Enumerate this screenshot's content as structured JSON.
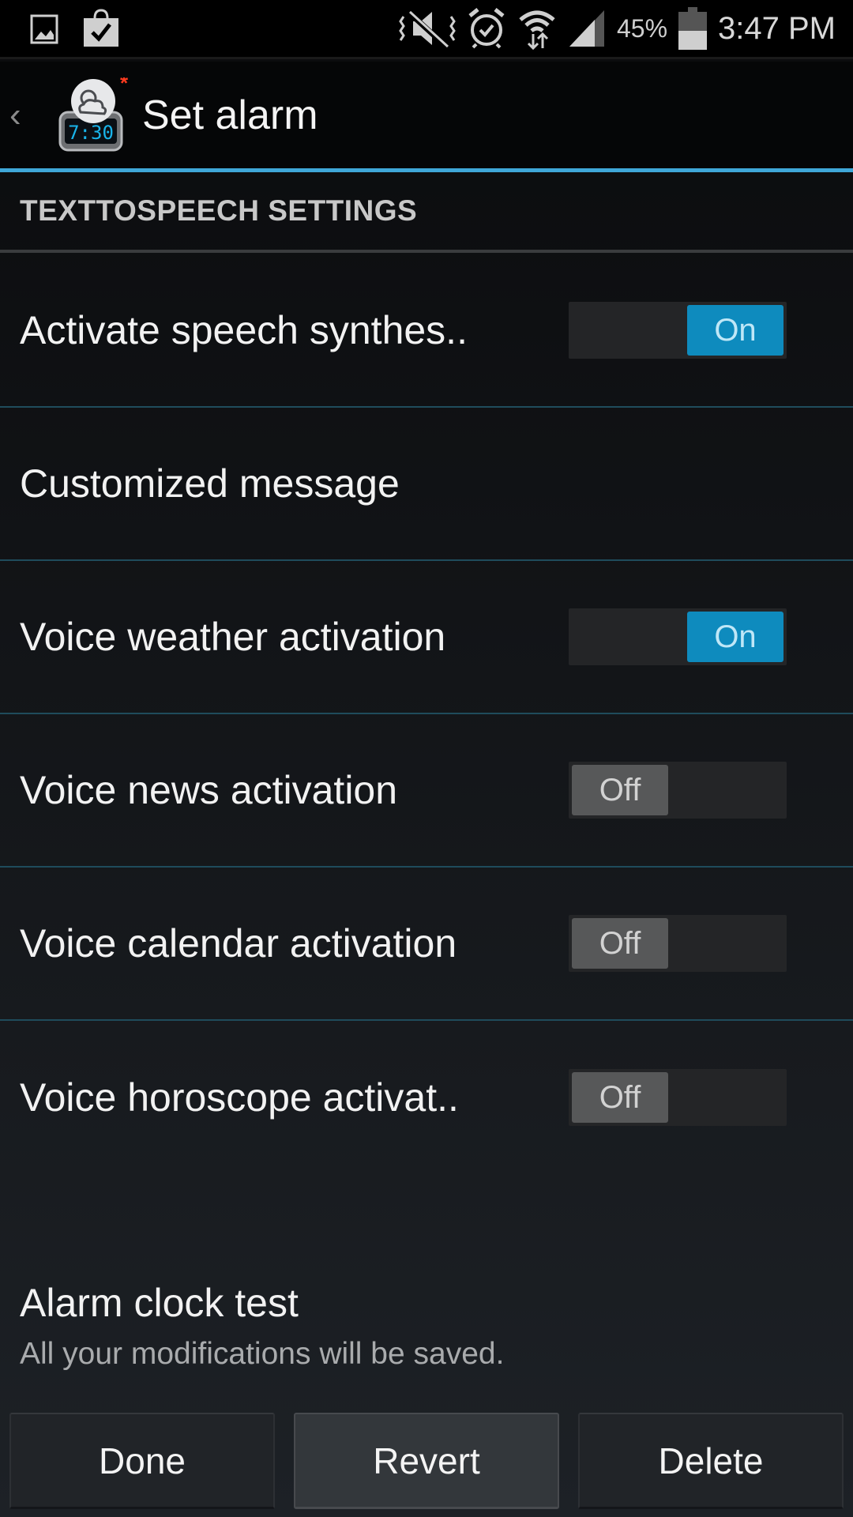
{
  "status_bar": {
    "left_icons": [
      "gallery-icon",
      "shopping-bag-check-icon"
    ],
    "right_icons": [
      "vibrate-mute-icon",
      "alarm-icon",
      "wifi-icon",
      "signal-icon"
    ],
    "battery_percent": "45%",
    "battery_level": 0.45,
    "time": "3:47 PM"
  },
  "action_bar": {
    "back_glyph": "‹",
    "app_icon": "weather-alarm-clock-icon",
    "app_icon_clock": "7:30",
    "title": "Set alarm"
  },
  "section": {
    "title": "TEXTTOSPEECH SETTINGS"
  },
  "settings": [
    {
      "label": "Activate speech synthes..",
      "toggle": "On",
      "state": true
    },
    {
      "label": "Customized message"
    },
    {
      "label": "Voice weather activation",
      "toggle": "On",
      "state": true
    },
    {
      "label": "Voice news activation",
      "toggle": "Off",
      "state": false
    },
    {
      "label": "Voice calendar activation",
      "toggle": "Off",
      "state": false
    },
    {
      "label": "Voice horoscope activat..",
      "toggle": "Off",
      "state": false
    }
  ],
  "alarm_test": {
    "title": "Alarm clock test",
    "subtitle": "All your modifications will be saved."
  },
  "buttons": {
    "done": "Done",
    "revert": "Revert",
    "delete": "Delete"
  },
  "colors": {
    "accent": "#3fa7d8",
    "toggle_on": "#0e8bbe",
    "toggle_off": "#575859"
  }
}
